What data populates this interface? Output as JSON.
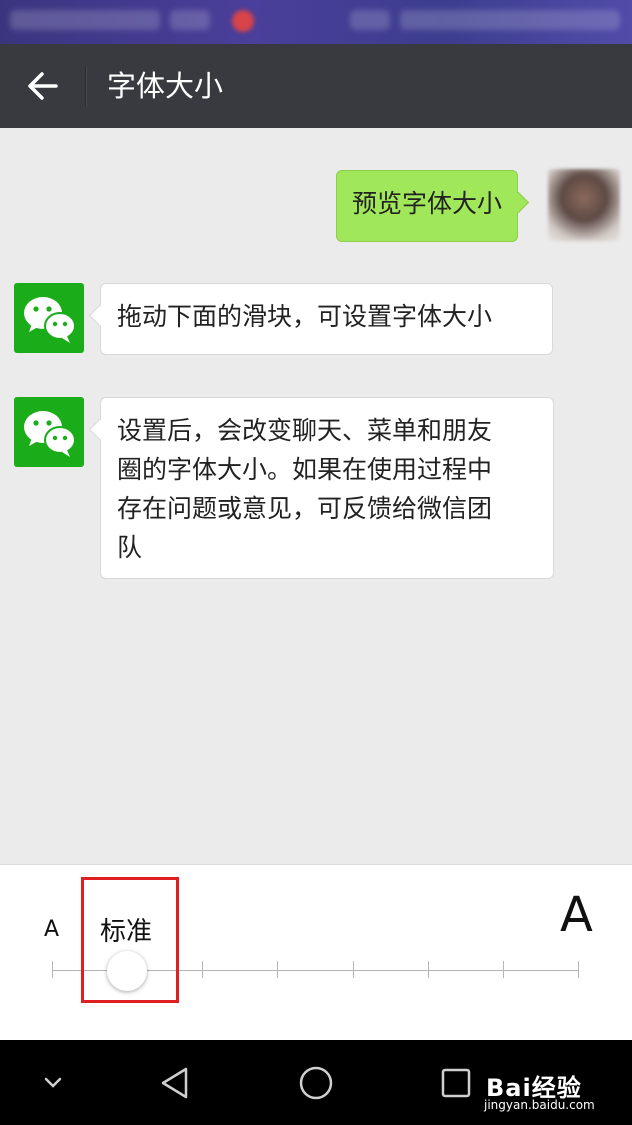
{
  "header": {
    "title": "字体大小",
    "back_icon": "arrow-left-icon"
  },
  "chat": {
    "messages": [
      {
        "side": "right",
        "text": "预览字体大小"
      },
      {
        "side": "left",
        "text": "拖动下面的滑块，可设置字体大小"
      },
      {
        "side": "left",
        "lines": [
          "设置后，会改变聊天、菜单和朋友",
          "圈的字体大小。如果在使用过程中",
          "存在问题或意见，可反馈给微信团",
          "队"
        ]
      }
    ]
  },
  "font_slider": {
    "small_label": "A",
    "large_label": "A",
    "current_level_label": "标准",
    "steps": 8,
    "selected_step_index": 1
  },
  "watermark": {
    "brand": "Bai经验",
    "url": "jingyan.baidu.com"
  },
  "colors": {
    "title_bar": "#393a3f",
    "bubble_green": "#a0e75a",
    "wechat_green": "#1aad19",
    "highlight_box": "#e02020"
  }
}
